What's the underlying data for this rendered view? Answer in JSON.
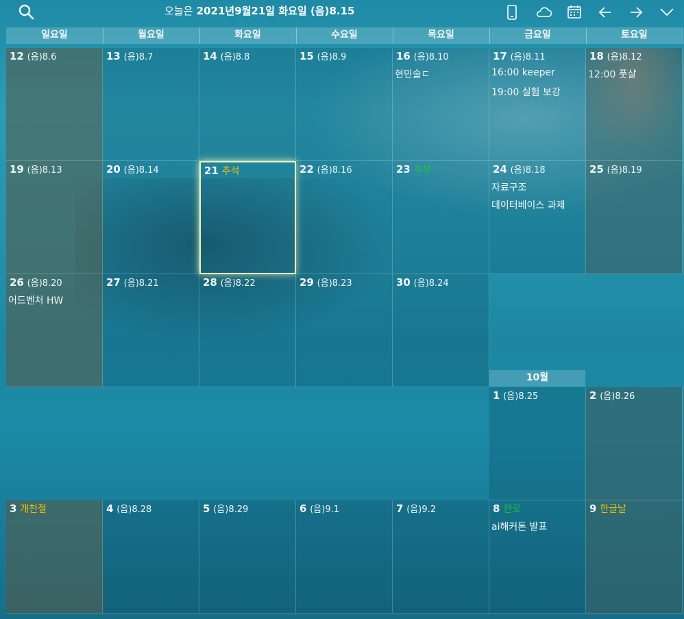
{
  "header": {
    "title_prefix": "오늘은",
    "title_date": "2021년9월21일 화요일 (음)8.15"
  },
  "weekdays": [
    "일요일",
    "월요일",
    "화요일",
    "수요일",
    "목요일",
    "금요일",
    "토요일"
  ],
  "month2_label": "10월",
  "days": [
    {
      "d": "12",
      "lunar": "(음)8.6",
      "events": []
    },
    {
      "d": "13",
      "lunar": "(음)8.7",
      "events": []
    },
    {
      "d": "14",
      "lunar": "(음)8.8",
      "events": []
    },
    {
      "d": "15",
      "lunar": "(음)8.9",
      "events": []
    },
    {
      "d": "16",
      "lunar": "(음)8.10",
      "events": [
        "현민술ㄷ"
      ]
    },
    {
      "d": "17",
      "lunar": "(음)8.11",
      "events": [
        "16:00 keeper",
        "19:00 실험 보강"
      ]
    },
    {
      "d": "18",
      "lunar": "(음)8.12",
      "events": [
        "12:00 풋살"
      ]
    },
    {
      "d": "19",
      "lunar": "(음)8.13",
      "events": []
    },
    {
      "d": "20",
      "lunar": "(음)8.14",
      "events": []
    },
    {
      "d": "21",
      "holiday": "추석",
      "holiday_color": "gold",
      "events": []
    },
    {
      "d": "22",
      "lunar": "(음)8.16",
      "events": []
    },
    {
      "d": "23",
      "holiday": "추분",
      "holiday_color": "green",
      "events": []
    },
    {
      "d": "24",
      "lunar": "(음)8.18",
      "events": [
        "자료구조",
        "데이터베이스 과제"
      ]
    },
    {
      "d": "25",
      "lunar": "(음)8.19",
      "events": []
    },
    {
      "d": "26",
      "lunar": "(음)8.20",
      "events": [
        "어드벤처 HW"
      ]
    },
    {
      "d": "27",
      "lunar": "(음)8.21",
      "events": []
    },
    {
      "d": "28",
      "lunar": "(음)8.22",
      "events": []
    },
    {
      "d": "29",
      "lunar": "(음)8.23",
      "events": []
    },
    {
      "d": "30",
      "lunar": "(음)8.24",
      "events": []
    },
    {
      "d": "1",
      "lunar": "(음)8.25",
      "events": []
    },
    {
      "d": "2",
      "lunar": "(음)8.26",
      "events": []
    },
    {
      "d": "3",
      "holiday": "개천절",
      "holiday_color": "gold",
      "events": []
    },
    {
      "d": "4",
      "lunar": "(음)8.28",
      "events": []
    },
    {
      "d": "5",
      "lunar": "(음)8.29",
      "events": []
    },
    {
      "d": "6",
      "lunar": "(음)9.1",
      "events": []
    },
    {
      "d": "7",
      "lunar": "(음)9.2",
      "events": []
    },
    {
      "d": "8",
      "holiday": "한로",
      "holiday_color": "green",
      "events": [
        "ai해커톤 발표"
      ]
    },
    {
      "d": "9",
      "holiday": "한글날",
      "holiday_color": "gold",
      "events": []
    }
  ]
}
